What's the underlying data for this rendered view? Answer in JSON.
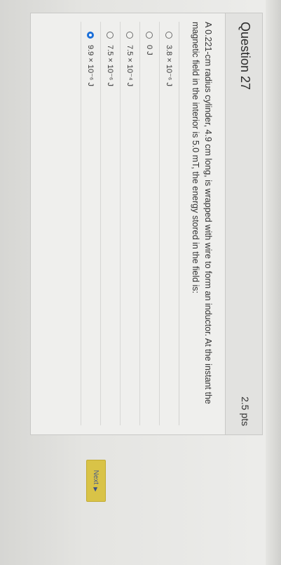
{
  "question": {
    "title": "Question 27",
    "points": "2.5 pts",
    "text": "A 0.221-cm radius cylinder, 4.9 cm long, is wrapped with wire to form an inductor. At the instant the magnetic field in the interior is 5.0 mT, the energy stored in the field is:"
  },
  "answers": [
    {
      "label": "3.8 × 10⁻⁶ J",
      "selected": false
    },
    {
      "label": "0 J",
      "selected": false
    },
    {
      "label": "7.5 × 10⁻⁴ J",
      "selected": false
    },
    {
      "label": "7.5 × 10⁻⁶ J",
      "selected": false
    },
    {
      "label": "9.9 × 10⁻⁶ J",
      "selected": true
    }
  ],
  "navigation": {
    "next_label": "Next",
    "next_icon": "play-arrow-icon"
  },
  "colors": {
    "accent": "#1b6fd8",
    "next_button": "#d9c347"
  }
}
